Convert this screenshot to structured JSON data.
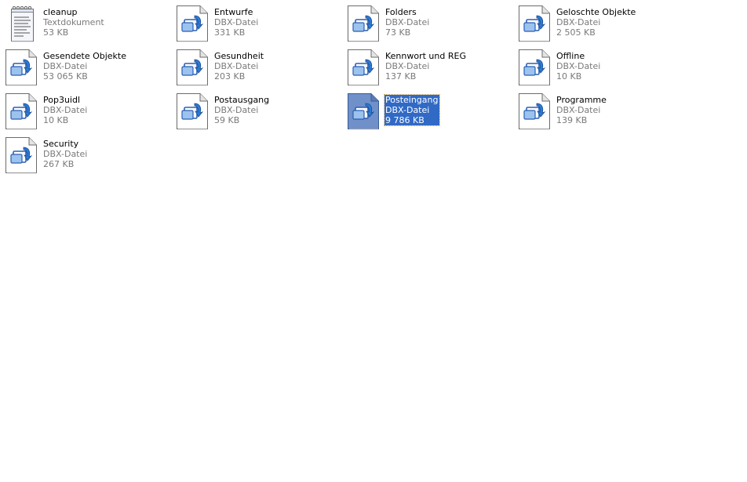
{
  "files": [
    {
      "name": "cleanup",
      "type": "Textdokument",
      "size": "53 KB",
      "icon": "text-document-icon",
      "selected": false
    },
    {
      "name": "Entwurfe",
      "type": "DBX-Datei",
      "size": "331 KB",
      "icon": "dbx-file-icon",
      "selected": false
    },
    {
      "name": "Folders",
      "type": "DBX-Datei",
      "size": "73 KB",
      "icon": "dbx-file-icon",
      "selected": false
    },
    {
      "name": "Geloschte Objekte",
      "type": "DBX-Datei",
      "size": "2 505 KB",
      "icon": "dbx-file-icon",
      "selected": false
    },
    {
      "name": "Gesendete Objekte",
      "type": "DBX-Datei",
      "size": "53 065 KB",
      "icon": "dbx-file-icon",
      "selected": false
    },
    {
      "name": "Gesundheit",
      "type": "DBX-Datei",
      "size": "203 KB",
      "icon": "dbx-file-icon",
      "selected": false
    },
    {
      "name": "Kennwort und REG",
      "type": "DBX-Datei",
      "size": "137 KB",
      "icon": "dbx-file-icon",
      "selected": false
    },
    {
      "name": "Offline",
      "type": "DBX-Datei",
      "size": "10 KB",
      "icon": "dbx-file-icon",
      "selected": false
    },
    {
      "name": "Pop3uidl",
      "type": "DBX-Datei",
      "size": "10 KB",
      "icon": "dbx-file-icon",
      "selected": false
    },
    {
      "name": "Postausgang",
      "type": "DBX-Datei",
      "size": "59 KB",
      "icon": "dbx-file-icon",
      "selected": false
    },
    {
      "name": "Posteingang",
      "type": "DBX-Datei",
      "size": "9 786 KB",
      "icon": "dbx-file-icon",
      "selected": true
    },
    {
      "name": "Programme",
      "type": "DBX-Datei",
      "size": "139 KB",
      "icon": "dbx-file-icon",
      "selected": false
    },
    {
      "name": "Security",
      "type": "DBX-Datei",
      "size": "267 KB",
      "icon": "dbx-file-icon",
      "selected": false
    }
  ],
  "colors": {
    "selection_background": "#316ac5",
    "selection_text": "#ffffff",
    "meta_text": "#7a7a7a",
    "background": "#ffffff"
  }
}
